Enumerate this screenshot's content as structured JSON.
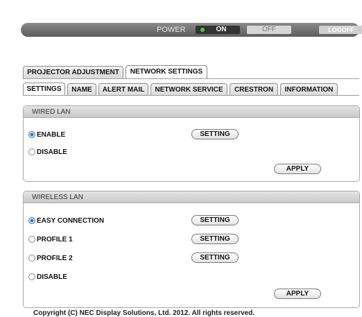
{
  "power_bar": {
    "label": "POWER",
    "on_label": "ON",
    "off_label": "OFF",
    "logoff_label": "LOGOFF",
    "state": "on",
    "led_color": "#37d13a"
  },
  "main_tabs": [
    "PROJECTOR ADJUSTMENT",
    "NETWORK SETTINGS"
  ],
  "main_tab_active": "NETWORK SETTINGS",
  "sub_tabs": [
    "SETTINGS",
    "NAME",
    "ALERT MAIL",
    "NETWORK SERVICE",
    "CRESTRON",
    "INFORMATION"
  ],
  "sub_tab_active": "SETTINGS",
  "wired_lan": {
    "title": "WIRED LAN",
    "options": [
      {
        "label": "ENABLE",
        "checked": true,
        "has_setting": true
      },
      {
        "label": "DISABLE",
        "checked": false,
        "has_setting": false
      }
    ],
    "setting_label": "SETTING",
    "apply_label": "APPLY"
  },
  "wireless_lan": {
    "title": "WIRELESS LAN",
    "options": [
      {
        "label": "EASY CONNECTION",
        "checked": true,
        "has_setting": true
      },
      {
        "label": "PROFILE 1",
        "checked": false,
        "has_setting": true
      },
      {
        "label": "PROFILE 2",
        "checked": false,
        "has_setting": true
      },
      {
        "label": "DISABLE",
        "checked": false,
        "has_setting": false
      }
    ],
    "setting_label": "SETTING",
    "apply_label": "APPLY"
  },
  "copyright": "Copyright (C) NEC Display Solutions, Ltd. 2012. All rights reserved."
}
